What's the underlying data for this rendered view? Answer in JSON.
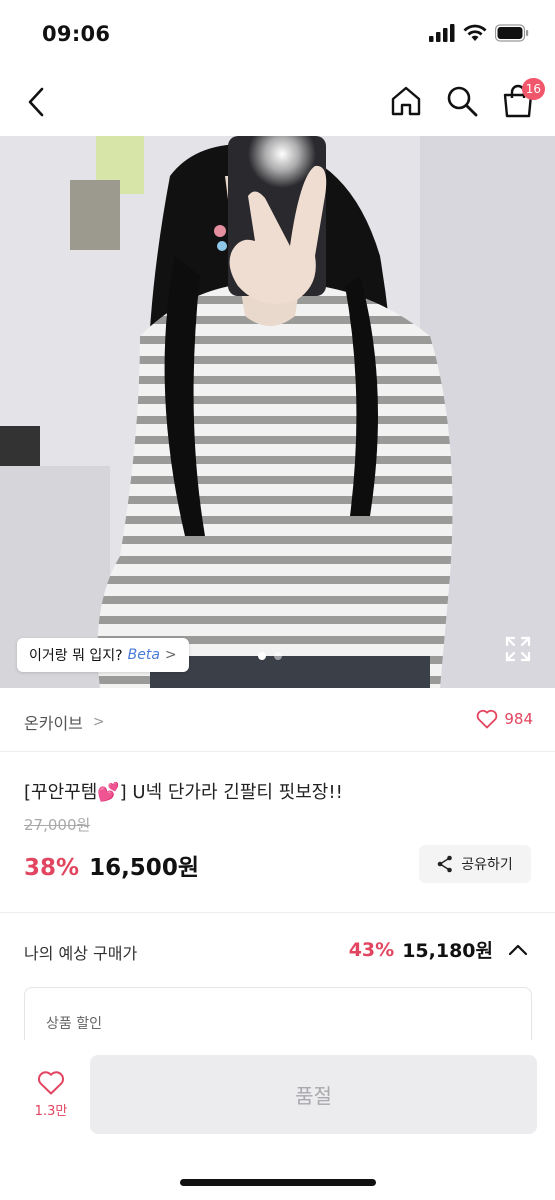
{
  "status": {
    "time": "09:06"
  },
  "nav": {
    "cart_count": "16"
  },
  "image": {
    "ai_chip_label": "이거랑 뭐 입지?",
    "ai_chip_beta": "Beta",
    "ai_chip_chevron": ">",
    "slide_index": 1,
    "slide_total": 2
  },
  "brand": {
    "name": "온카이브",
    "chevron": ">",
    "likes": "984"
  },
  "product": {
    "title": "[꾸안꾸템💕] U넥 단가라 긴팔티 핏보장!!",
    "original_price": "27,000원",
    "discount": "38%",
    "sale_price": "16,500원",
    "share_label": "공유하기"
  },
  "expected": {
    "label": "나의 예상 구매가",
    "discount": "43%",
    "price": "15,180원"
  },
  "discount_box": {
    "label": "상품 할인"
  },
  "bottom": {
    "wish_count": "1.3만",
    "soldout_label": "품절"
  },
  "colors": {
    "accent": "#e2455f",
    "badge": "#f0576b"
  },
  "icons": [
    "back-icon",
    "home-icon",
    "search-icon",
    "cart-icon",
    "expand-icon",
    "heart-icon",
    "share-icon",
    "chevron-up-icon"
  ]
}
